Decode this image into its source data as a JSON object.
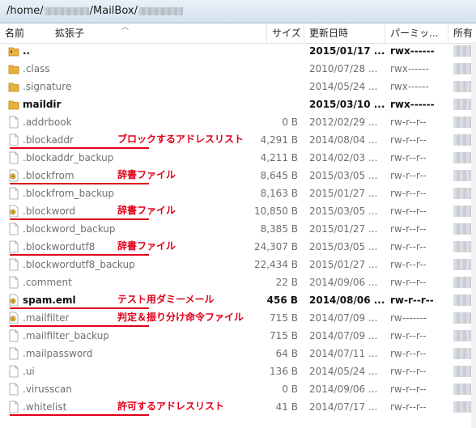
{
  "path": {
    "prefix": "/home/",
    "middle": "/MailBox/"
  },
  "columns": {
    "name": "名前",
    "ext": "拡張子",
    "size": "サイズ",
    "date": "更新日時",
    "perm": "パーミッ...",
    "owner": "所有"
  },
  "rows": [
    {
      "name": "..",
      "size": "",
      "date": "2015/01/17 ...",
      "perm": "rwx------",
      "icon": "folder-up-icon",
      "bold": true
    },
    {
      "name": ".class",
      "size": "",
      "date": "2010/07/28 ...",
      "perm": "rwx------",
      "icon": "folder-icon",
      "bold": false
    },
    {
      "name": ".signature",
      "size": "",
      "date": "2014/05/24 ...",
      "perm": "rwx------",
      "icon": "folder-icon",
      "bold": false
    },
    {
      "name": "maildir",
      "size": "",
      "date": "2015/03/10 ...",
      "perm": "rwx------",
      "icon": "folder-icon",
      "bold": true
    },
    {
      "name": ".addrbook",
      "size": "0 B",
      "date": "2012/02/29 ...",
      "perm": "rw-r--r--",
      "icon": "file-icon",
      "bold": false
    },
    {
      "name": ".blockaddr",
      "size": "4,291 B",
      "date": "2014/08/04 ...",
      "perm": "rw-r--r--",
      "icon": "file-icon",
      "bold": false
    },
    {
      "name": ".blockaddr_backup",
      "size": "4,211 B",
      "date": "2014/02/03 ...",
      "perm": "rw-r--r--",
      "icon": "file-icon",
      "bold": false
    },
    {
      "name": ".blockfrom",
      "size": "8,645 B",
      "date": "2015/03/05 ...",
      "perm": "rw-r--r--",
      "icon": "script-file-icon",
      "bold": false
    },
    {
      "name": ".blockfrom_backup",
      "size": "8,163 B",
      "date": "2015/01/27 ...",
      "perm": "rw-r--r--",
      "icon": "file-icon",
      "bold": false
    },
    {
      "name": ".blockword",
      "size": "10,850 B",
      "date": "2015/03/05 ...",
      "perm": "rw-r--r--",
      "icon": "script-file-icon",
      "bold": false
    },
    {
      "name": ".blockword_backup",
      "size": "8,385 B",
      "date": "2015/01/27 ...",
      "perm": "rw-r--r--",
      "icon": "file-icon",
      "bold": false
    },
    {
      "name": ".blockwordutf8",
      "size": "24,307 B",
      "date": "2015/03/05 ...",
      "perm": "rw-r--r--",
      "icon": "file-icon",
      "bold": false
    },
    {
      "name": ".blockwordutf8_backup",
      "size": "22,434 B",
      "date": "2015/01/27 ...",
      "perm": "rw-r--r--",
      "icon": "file-icon",
      "bold": false
    },
    {
      "name": ".comment",
      "size": "22 B",
      "date": "2014/09/06 ...",
      "perm": "rw-r--r--",
      "icon": "file-icon",
      "bold": false
    },
    {
      "name": "spam.eml",
      "size": "456 B",
      "date": "2014/08/06 ...",
      "perm": "rw-r--r--",
      "icon": "script-file-icon",
      "bold": true
    },
    {
      "name": ".mailfilter",
      "size": "715 B",
      "date": "2014/07/09 ...",
      "perm": "rw-------",
      "icon": "script-file-icon",
      "bold": false
    },
    {
      "name": ".mailfilter_backup",
      "size": "715 B",
      "date": "2014/07/09 ...",
      "perm": "rw-r--r--",
      "icon": "file-icon",
      "bold": false
    },
    {
      "name": ".mailpassword",
      "size": "64 B",
      "date": "2014/07/11 ...",
      "perm": "rw-r--r--",
      "icon": "file-icon",
      "bold": false
    },
    {
      "name": ".ui",
      "size": "136 B",
      "date": "2014/05/24 ...",
      "perm": "rw-r--r--",
      "icon": "file-icon",
      "bold": false
    },
    {
      "name": ".virusscan",
      "size": "0 B",
      "date": "2014/09/06 ...",
      "perm": "rw-r--r--",
      "icon": "file-icon",
      "bold": false
    },
    {
      "name": ".whitelist",
      "size": "41 B",
      "date": "2014/07/17 ...",
      "perm": "rw-r--r--",
      "icon": "file-icon",
      "bold": false
    }
  ],
  "annotations": [
    {
      "row": 5,
      "text": "ブロックするアドレスリスト"
    },
    {
      "row": 7,
      "text": "辞書ファイル"
    },
    {
      "row": 9,
      "text": "辞書ファイル"
    },
    {
      "row": 11,
      "text": "辞書ファイル"
    },
    {
      "row": 14,
      "text": "テスト用ダミーメール"
    },
    {
      "row": 15,
      "text": "判定＆振り分け命令ファイル"
    },
    {
      "row": 20,
      "text": "許可するアドレスリスト"
    }
  ],
  "colors": {
    "annotation": "#e0001b",
    "folder": "#e8b23a"
  }
}
